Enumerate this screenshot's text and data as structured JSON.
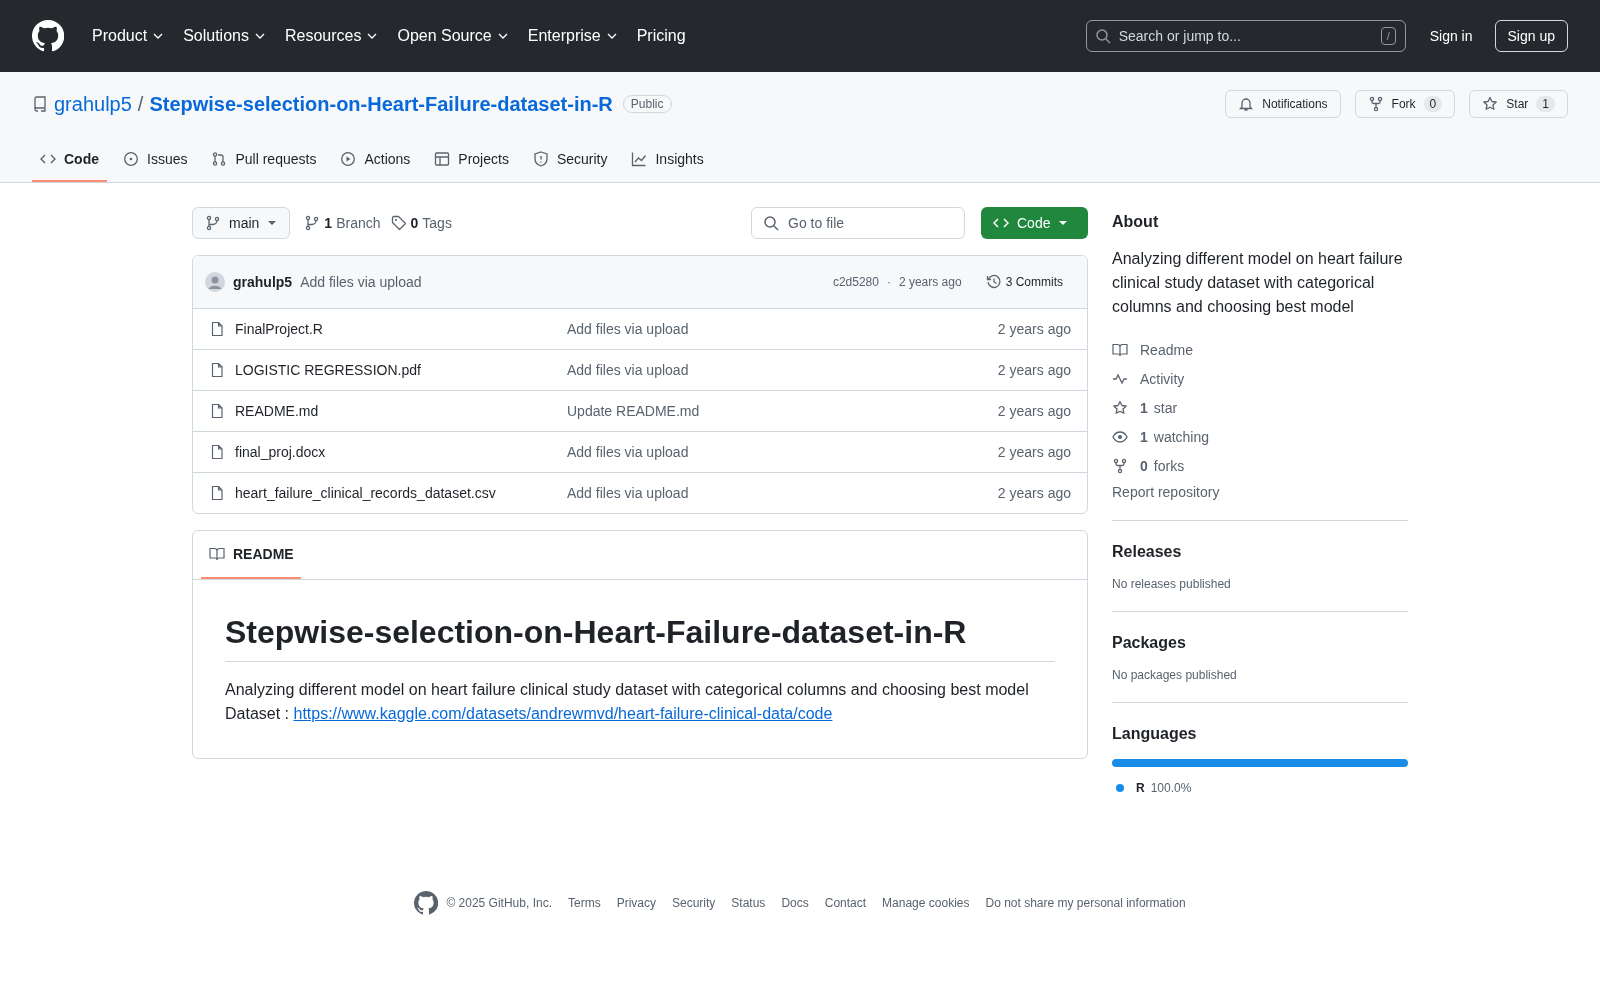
{
  "header": {
    "nav": [
      {
        "label": "Product",
        "dropdown": true
      },
      {
        "label": "Solutions",
        "dropdown": true
      },
      {
        "label": "Resources",
        "dropdown": true
      },
      {
        "label": "Open Source",
        "dropdown": true
      },
      {
        "label": "Enterprise",
        "dropdown": true
      },
      {
        "label": "Pricing",
        "dropdown": false
      }
    ],
    "search": {
      "placeholder": "Search or jump to...",
      "shortcut": "/"
    },
    "sign_in": "Sign in",
    "sign_up": "Sign up"
  },
  "repo": {
    "owner": "grahulp5",
    "separator": "/",
    "name": "Stepwise-selection-on-Heart-Failure-dataset-in-R",
    "visibility": "Public",
    "actions": [
      {
        "kind": "bell",
        "label": "Notifications"
      },
      {
        "kind": "fork",
        "label": "Fork",
        "count": "0"
      },
      {
        "kind": "star",
        "label": "Star",
        "count": "1"
      }
    ]
  },
  "tabs": [
    {
      "kind": "code",
      "label": "Code",
      "selected": true
    },
    {
      "kind": "issue",
      "label": "Issues",
      "selected": false
    },
    {
      "kind": "pr",
      "label": "Pull requests",
      "selected": false
    },
    {
      "kind": "play",
      "label": "Actions",
      "selected": false
    },
    {
      "kind": "table",
      "label": "Projects",
      "selected": false
    },
    {
      "kind": "shield",
      "label": "Security",
      "selected": false
    },
    {
      "kind": "graph",
      "label": "Insights",
      "selected": false
    }
  ],
  "toolbar": {
    "branch": "main",
    "branches": {
      "count": "1",
      "label": "Branch"
    },
    "tags": {
      "count": "0",
      "label": "Tags"
    },
    "go_to_file": {
      "placeholder": "Go to file"
    },
    "code_button": "Code"
  },
  "commit": {
    "author": "grahulp5",
    "message": "Add files via upload",
    "hash": "c2d5280",
    "separator": "·",
    "time": "2 years ago",
    "commits": "3 Commits"
  },
  "files": [
    {
      "name": "FinalProject.R",
      "message": "Add files via upload",
      "time": "2 years ago"
    },
    {
      "name": "LOGISTIC REGRESSION.pdf",
      "message": "Add files via upload",
      "time": "2 years ago"
    },
    {
      "name": "README.md",
      "message": "Update README.md",
      "time": "2 years ago"
    },
    {
      "name": "final_proj.docx",
      "message": "Add files via upload",
      "time": "2 years ago"
    },
    {
      "name": "heart_failure_clinical_records_dataset.csv",
      "message": "Add files via upload",
      "time": "2 years ago"
    }
  ],
  "readme": {
    "tab": "README",
    "title": "Stepwise-selection-on-Heart-Failure-dataset-in-R",
    "text": "Analyzing different model on heart failure clinical study dataset with categorical columns and choosing best model",
    "dataset_label": "Dataset :",
    "dataset_link": "https://www.kaggle.com/datasets/andrewmvd/heart-failure-clinical-data/code"
  },
  "about": {
    "title": "About",
    "description": "Analyzing different model on heart failure clinical study dataset with categorical columns and choosing best model",
    "links": [
      {
        "kind": "book",
        "label": "Readme"
      },
      {
        "kind": "pulse",
        "label": "Activity"
      },
      {
        "kind": "star",
        "count": "1",
        "label": "star"
      },
      {
        "kind": "eye",
        "count": "1",
        "label": "watching"
      },
      {
        "kind": "fork",
        "count": "0",
        "label": "forks"
      }
    ],
    "report": "Report repository"
  },
  "releases": {
    "title": "Releases",
    "note": "No releases published"
  },
  "packages": {
    "title": "Packages",
    "note": "No packages published"
  },
  "languages": {
    "title": "Languages",
    "items": [
      {
        "name": "R",
        "percent": "100.0%",
        "level": 1,
        "color": "#198ce7"
      }
    ]
  },
  "footer": {
    "copyright": "© 2025 GitHub, Inc.",
    "links": [
      "Terms",
      "Privacy",
      "Security",
      "Status",
      "Docs",
      "Contact",
      "Manage cookies",
      "Do not share my personal information"
    ]
  }
}
